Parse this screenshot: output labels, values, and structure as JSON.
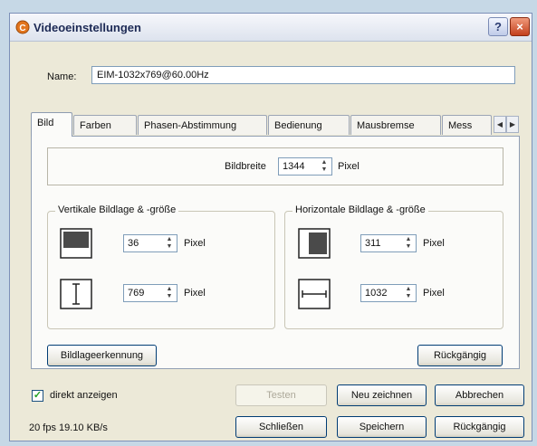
{
  "window": {
    "title": "Videoeinstellungen",
    "help_label": "?",
    "close_label": "×"
  },
  "name": {
    "label": "Name:",
    "value": "EIM-1032x769@60.00Hz"
  },
  "tabs": [
    {
      "label": "Bild"
    },
    {
      "label": "Farben"
    },
    {
      "label": "Phasen-Abstimmung"
    },
    {
      "label": "Bedienung"
    },
    {
      "label": "Mausbremse"
    },
    {
      "label": "Mess"
    }
  ],
  "tab_scroll": {
    "left": "◀",
    "right": "▶"
  },
  "bildbreite": {
    "label": "Bildbreite",
    "value": "1344",
    "unit": "Pixel"
  },
  "vertical": {
    "title": "Vertikale Bildlage & -größe",
    "position": {
      "value": "36",
      "unit": "Pixel"
    },
    "size": {
      "value": "769",
      "unit": "Pixel"
    }
  },
  "horizontal": {
    "title": "Horizontale Bildlage & -größe",
    "position": {
      "value": "311",
      "unit": "Pixel"
    },
    "size": {
      "value": "1032",
      "unit": "Pixel"
    }
  },
  "buttons": {
    "detect": "Bildlageerkennung",
    "undo_panel": "Rückgängig",
    "test": "Testen",
    "redraw": "Neu zeichnen",
    "cancel": "Abbrechen",
    "close": "Schließen",
    "save": "Speichern",
    "undo": "Rückgängig"
  },
  "direct_show": {
    "label": "direkt anzeigen",
    "checked": true,
    "check_glyph": "✓"
  },
  "status": {
    "text": "20 fps  19.10 KB/s"
  },
  "colors": {
    "window_bg": "#ece9d8",
    "panel_bg": "#fbfbf9",
    "input_border": "#7f9db9",
    "close_red": "#c3401c"
  }
}
